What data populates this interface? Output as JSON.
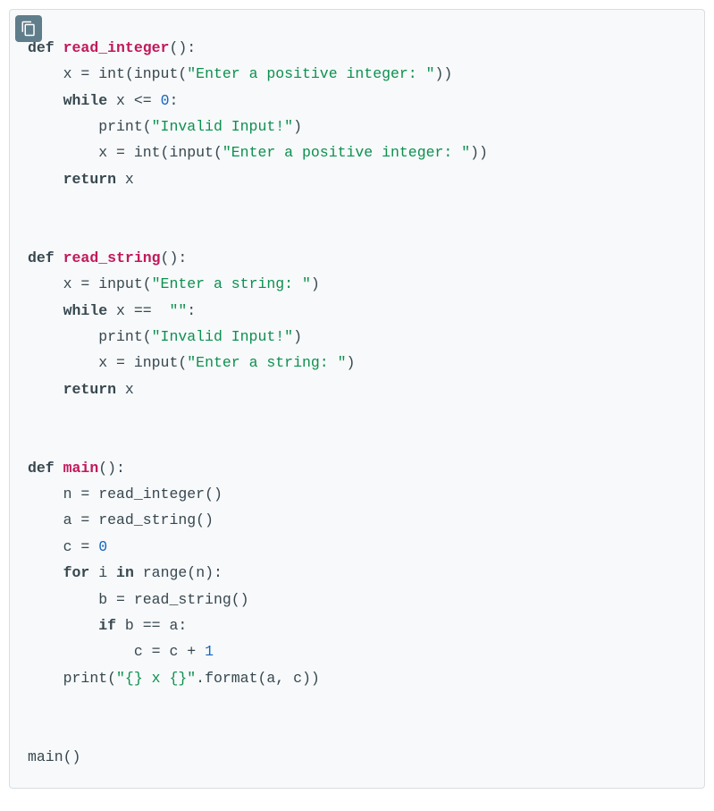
{
  "language": "python",
  "code_lines": [
    [
      {
        "t": "kw",
        "v": "def"
      },
      {
        "t": "sp",
        "v": " "
      },
      {
        "t": "fn",
        "v": "read_integer"
      },
      {
        "t": "op",
        "v": "():"
      }
    ],
    [
      {
        "t": "sp",
        "v": "    "
      },
      {
        "t": "id",
        "v": "x "
      },
      {
        "t": "op",
        "v": "="
      },
      {
        "t": "id",
        "v": " int"
      },
      {
        "t": "op",
        "v": "("
      },
      {
        "t": "id",
        "v": "input"
      },
      {
        "t": "op",
        "v": "("
      },
      {
        "t": "str",
        "v": "\"Enter a positive integer: \""
      },
      {
        "t": "op",
        "v": "))"
      }
    ],
    [
      {
        "t": "sp",
        "v": "    "
      },
      {
        "t": "kw",
        "v": "while"
      },
      {
        "t": "id",
        "v": " x "
      },
      {
        "t": "op",
        "v": "<="
      },
      {
        "t": "sp",
        "v": " "
      },
      {
        "t": "num",
        "v": "0"
      },
      {
        "t": "op",
        "v": ":"
      }
    ],
    [
      {
        "t": "sp",
        "v": "        "
      },
      {
        "t": "id",
        "v": "print"
      },
      {
        "t": "op",
        "v": "("
      },
      {
        "t": "str",
        "v": "\"Invalid Input!\""
      },
      {
        "t": "op",
        "v": ")"
      }
    ],
    [
      {
        "t": "sp",
        "v": "        "
      },
      {
        "t": "id",
        "v": "x "
      },
      {
        "t": "op",
        "v": "="
      },
      {
        "t": "id",
        "v": " int"
      },
      {
        "t": "op",
        "v": "("
      },
      {
        "t": "id",
        "v": "input"
      },
      {
        "t": "op",
        "v": "("
      },
      {
        "t": "str",
        "v": "\"Enter a positive integer: \""
      },
      {
        "t": "op",
        "v": "))"
      }
    ],
    [
      {
        "t": "sp",
        "v": "    "
      },
      {
        "t": "kw",
        "v": "return"
      },
      {
        "t": "id",
        "v": " x"
      }
    ],
    [],
    [],
    [
      {
        "t": "kw",
        "v": "def"
      },
      {
        "t": "sp",
        "v": " "
      },
      {
        "t": "fn",
        "v": "read_string"
      },
      {
        "t": "op",
        "v": "():"
      }
    ],
    [
      {
        "t": "sp",
        "v": "    "
      },
      {
        "t": "id",
        "v": "x "
      },
      {
        "t": "op",
        "v": "="
      },
      {
        "t": "id",
        "v": " input"
      },
      {
        "t": "op",
        "v": "("
      },
      {
        "t": "str",
        "v": "\"Enter a string: \""
      },
      {
        "t": "op",
        "v": ")"
      }
    ],
    [
      {
        "t": "sp",
        "v": "    "
      },
      {
        "t": "kw",
        "v": "while"
      },
      {
        "t": "id",
        "v": " x "
      },
      {
        "t": "op",
        "v": "=="
      },
      {
        "t": "sp",
        "v": "  "
      },
      {
        "t": "str",
        "v": "\"\""
      },
      {
        "t": "op",
        "v": ":"
      }
    ],
    [
      {
        "t": "sp",
        "v": "        "
      },
      {
        "t": "id",
        "v": "print"
      },
      {
        "t": "op",
        "v": "("
      },
      {
        "t": "str",
        "v": "\"Invalid Input!\""
      },
      {
        "t": "op",
        "v": ")"
      }
    ],
    [
      {
        "t": "sp",
        "v": "        "
      },
      {
        "t": "id",
        "v": "x "
      },
      {
        "t": "op",
        "v": "="
      },
      {
        "t": "id",
        "v": " input"
      },
      {
        "t": "op",
        "v": "("
      },
      {
        "t": "str",
        "v": "\"Enter a string: \""
      },
      {
        "t": "op",
        "v": ")"
      }
    ],
    [
      {
        "t": "sp",
        "v": "    "
      },
      {
        "t": "kw",
        "v": "return"
      },
      {
        "t": "id",
        "v": " x"
      }
    ],
    [],
    [],
    [
      {
        "t": "kw",
        "v": "def"
      },
      {
        "t": "sp",
        "v": " "
      },
      {
        "t": "fn",
        "v": "main"
      },
      {
        "t": "op",
        "v": "():"
      }
    ],
    [
      {
        "t": "sp",
        "v": "    "
      },
      {
        "t": "id",
        "v": "n "
      },
      {
        "t": "op",
        "v": "="
      },
      {
        "t": "id",
        "v": " read_integer"
      },
      {
        "t": "op",
        "v": "()"
      }
    ],
    [
      {
        "t": "sp",
        "v": "    "
      },
      {
        "t": "id",
        "v": "a "
      },
      {
        "t": "op",
        "v": "="
      },
      {
        "t": "id",
        "v": " read_string"
      },
      {
        "t": "op",
        "v": "()"
      }
    ],
    [
      {
        "t": "sp",
        "v": "    "
      },
      {
        "t": "id",
        "v": "c "
      },
      {
        "t": "op",
        "v": "="
      },
      {
        "t": "sp",
        "v": " "
      },
      {
        "t": "num",
        "v": "0"
      }
    ],
    [
      {
        "t": "sp",
        "v": "    "
      },
      {
        "t": "kw",
        "v": "for"
      },
      {
        "t": "id",
        "v": " i "
      },
      {
        "t": "kw",
        "v": "in"
      },
      {
        "t": "id",
        "v": " range"
      },
      {
        "t": "op",
        "v": "("
      },
      {
        "t": "id",
        "v": "n"
      },
      {
        "t": "op",
        "v": "):"
      }
    ],
    [
      {
        "t": "sp",
        "v": "        "
      },
      {
        "t": "id",
        "v": "b "
      },
      {
        "t": "op",
        "v": "="
      },
      {
        "t": "id",
        "v": " read_string"
      },
      {
        "t": "op",
        "v": "()"
      }
    ],
    [
      {
        "t": "sp",
        "v": "        "
      },
      {
        "t": "kw",
        "v": "if"
      },
      {
        "t": "id",
        "v": " b "
      },
      {
        "t": "op",
        "v": "=="
      },
      {
        "t": "id",
        "v": " a"
      },
      {
        "t": "op",
        "v": ":"
      }
    ],
    [
      {
        "t": "sp",
        "v": "            "
      },
      {
        "t": "id",
        "v": "c "
      },
      {
        "t": "op",
        "v": "="
      },
      {
        "t": "id",
        "v": " c "
      },
      {
        "t": "op",
        "v": "+"
      },
      {
        "t": "sp",
        "v": " "
      },
      {
        "t": "num",
        "v": "1"
      }
    ],
    [
      {
        "t": "sp",
        "v": "    "
      },
      {
        "t": "id",
        "v": "print"
      },
      {
        "t": "op",
        "v": "("
      },
      {
        "t": "str",
        "v": "\"{} x {}\""
      },
      {
        "t": "op",
        "v": "."
      },
      {
        "t": "id",
        "v": "format"
      },
      {
        "t": "op",
        "v": "("
      },
      {
        "t": "id",
        "v": "a"
      },
      {
        "t": "op",
        "v": ", "
      },
      {
        "t": "id",
        "v": "c"
      },
      {
        "t": "op",
        "v": "))"
      }
    ],
    [],
    [],
    [
      {
        "t": "id",
        "v": "main"
      },
      {
        "t": "op",
        "v": "()"
      }
    ]
  ],
  "copy_icon": "clipboard-icon"
}
